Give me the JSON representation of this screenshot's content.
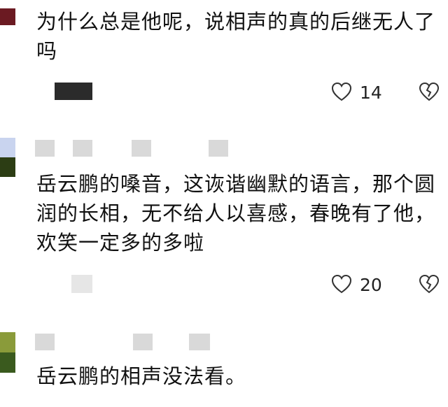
{
  "comments": [
    {
      "text": "为什么总是他呢，说相声的真的后继无人了吗",
      "like_count": "14"
    },
    {
      "text": "岳云鹏的嗓音，这诙谐幽默的语言，那个圆润的长相，无不给人以喜感，春晚有了他，欢笑一定多的多啦",
      "like_count": "20"
    },
    {
      "text": "岳云鹏的相声没法看。",
      "like_count": ""
    }
  ],
  "icons": {
    "like": "heart-outline-icon",
    "dislike": "broken-heart-icon"
  }
}
